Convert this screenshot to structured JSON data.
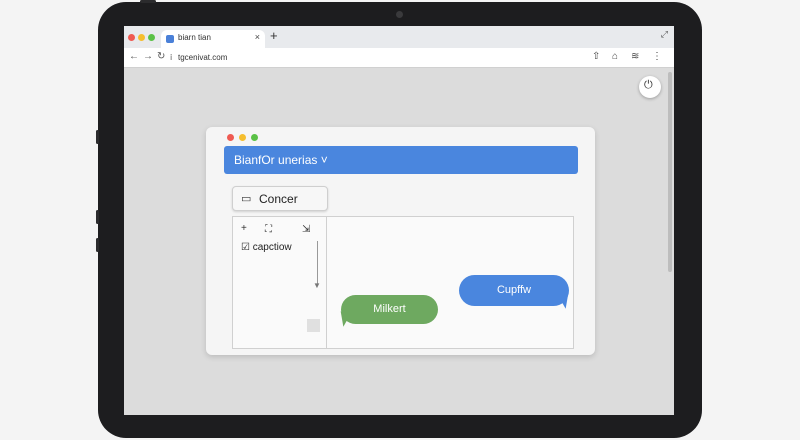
{
  "browser": {
    "tab_title": "biarn tian",
    "tab_close": "×",
    "new_tab": "+",
    "window_control": "⤢",
    "back": "←",
    "forward": "→",
    "reload": "↻",
    "url": "tgcenivat.com",
    "url_icon": "ⅰ",
    "toolbar_icons": [
      "⇧",
      "⌂",
      "≋",
      "⋮"
    ]
  },
  "app": {
    "title_bar": "BianfOr unerias ˅",
    "concer_button": "Concer",
    "concer_icon": "▭",
    "panel_icons": [
      "+",
      "⛶",
      "⇲"
    ],
    "caption": "☑ capctiow",
    "bubble_green": "Milkert",
    "bubble_blue": "Cupffw"
  },
  "extension_icon": "⏻",
  "colors": {
    "accent_blue": "#4a86de",
    "accent_green": "#6ea960",
    "dot_red": "#ef5a52",
    "dot_yellow": "#f5be2e",
    "dot_green": "#5ac146"
  }
}
